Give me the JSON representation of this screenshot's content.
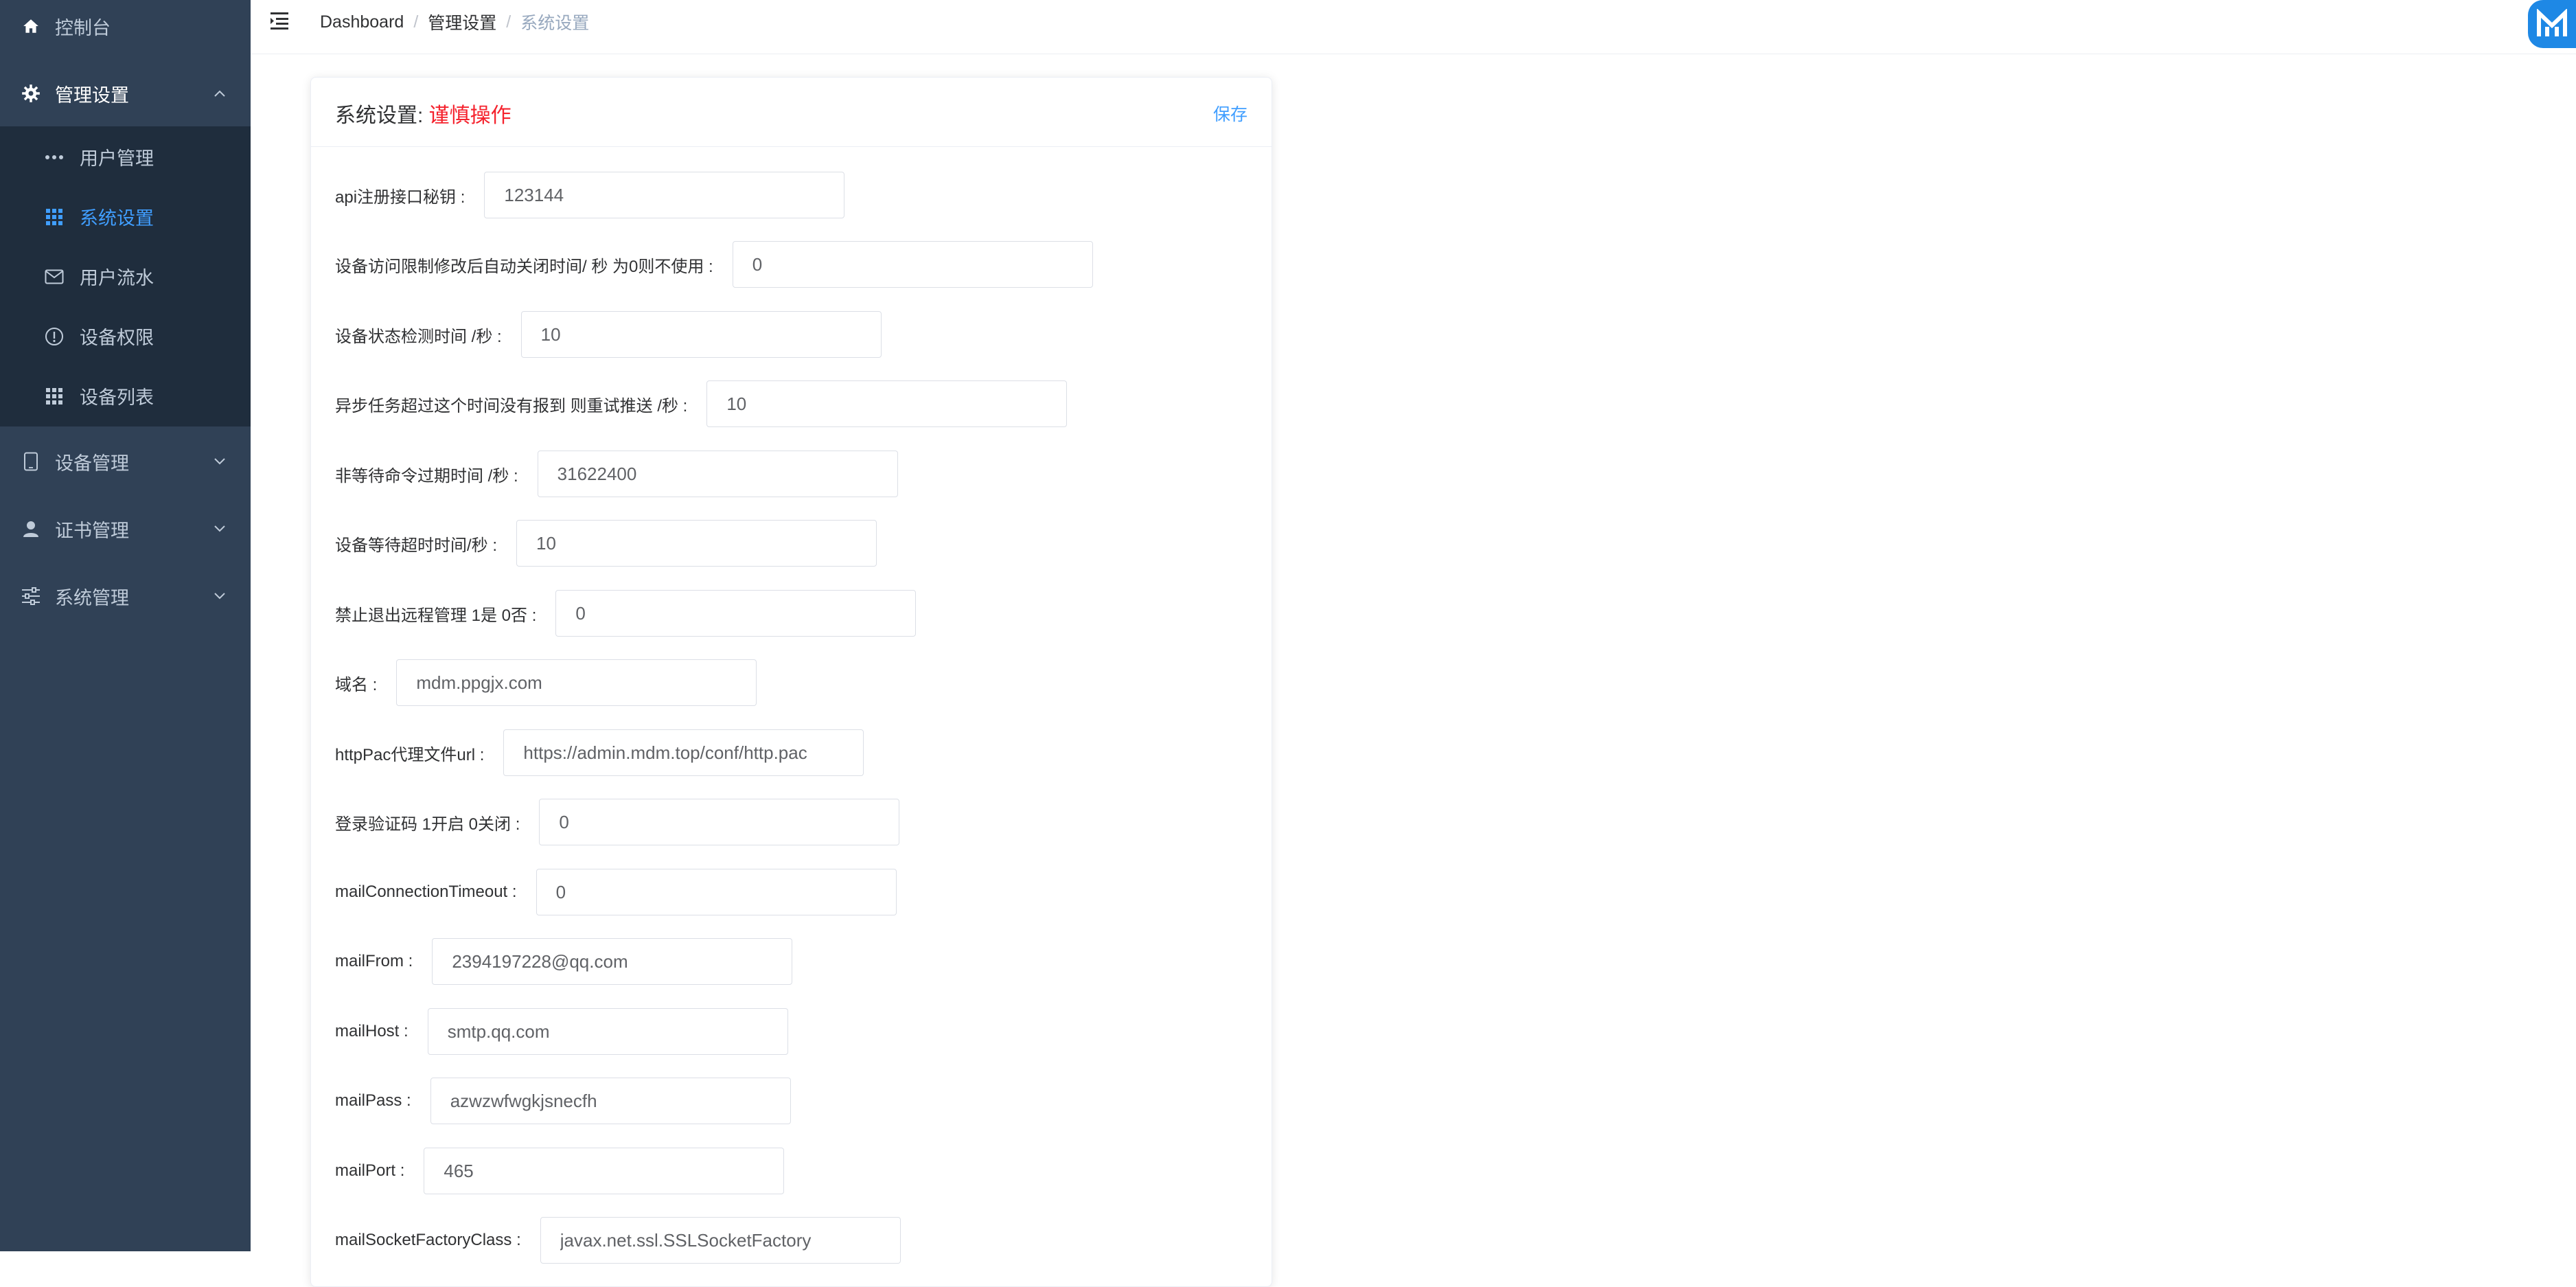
{
  "sidebar": {
    "items": [
      {
        "label": "控制台",
        "icon": "home-icon"
      },
      {
        "label": "管理设置",
        "icon": "gear-icon"
      },
      {
        "label": "设备管理",
        "icon": "tablet-icon"
      },
      {
        "label": "证书管理",
        "icon": "user-icon"
      },
      {
        "label": "系统管理",
        "icon": "sliders-icon"
      }
    ],
    "sub_items": [
      {
        "label": "用户管理",
        "icon": "more-dots-icon"
      },
      {
        "label": "系统设置",
        "icon": "grid-icon",
        "active": true
      },
      {
        "label": "用户流水",
        "icon": "envelope-icon"
      },
      {
        "label": "设备权限",
        "icon": "info-circle-icon"
      },
      {
        "label": "设备列表",
        "icon": "grid-icon"
      }
    ]
  },
  "breadcrumb": [
    "Dashboard",
    "管理设置",
    "系统设置"
  ],
  "card": {
    "title": "系统设置: ",
    "title_warning": "谨慎操作",
    "save_label": "保存"
  },
  "form": {
    "fields": [
      {
        "label": "api注册接口秘钥 :",
        "value": "123144"
      },
      {
        "label": "设备访问限制修改后自动关闭时间/ 秒 为0则不使用 :",
        "value": "0"
      },
      {
        "label": "设备状态检测时间 /秒 :",
        "value": "10"
      },
      {
        "label": "异步任务超过这个时间没有报到 则重试推送 /秒 :",
        "value": "10"
      },
      {
        "label": "非等待命令过期时间 /秒 :",
        "value": "31622400"
      },
      {
        "label": "设备等待超时时间/秒 :",
        "value": "10"
      },
      {
        "label": "禁止退出远程管理 1是 0否 :",
        "value": "0"
      },
      {
        "label": "域名 :",
        "value": "mdm.ppgjx.com"
      },
      {
        "label": "httpPac代理文件url :",
        "value": "https://admin.mdm.top/conf/http.pac"
      },
      {
        "label": "登录验证码 1开启 0关闭 :",
        "value": "0"
      },
      {
        "label": "mailConnectionTimeout :",
        "value": "0"
      },
      {
        "label": "mailFrom :",
        "value": "2394197228@qq.com"
      },
      {
        "label": "mailHost :",
        "value": "smtp.qq.com"
      },
      {
        "label": "mailPass :",
        "value": "azwzwfwgkjsnecfh"
      },
      {
        "label": "mailPort :",
        "value": "465"
      },
      {
        "label": "mailSocketFactoryClass :",
        "value": "javax.net.ssl.SSLSocketFactory"
      }
    ]
  },
  "colors": {
    "sidebar_bg": "#304156",
    "submenu_bg": "#1f2d3d",
    "accent": "#409eff",
    "warning": "#f5222d"
  }
}
